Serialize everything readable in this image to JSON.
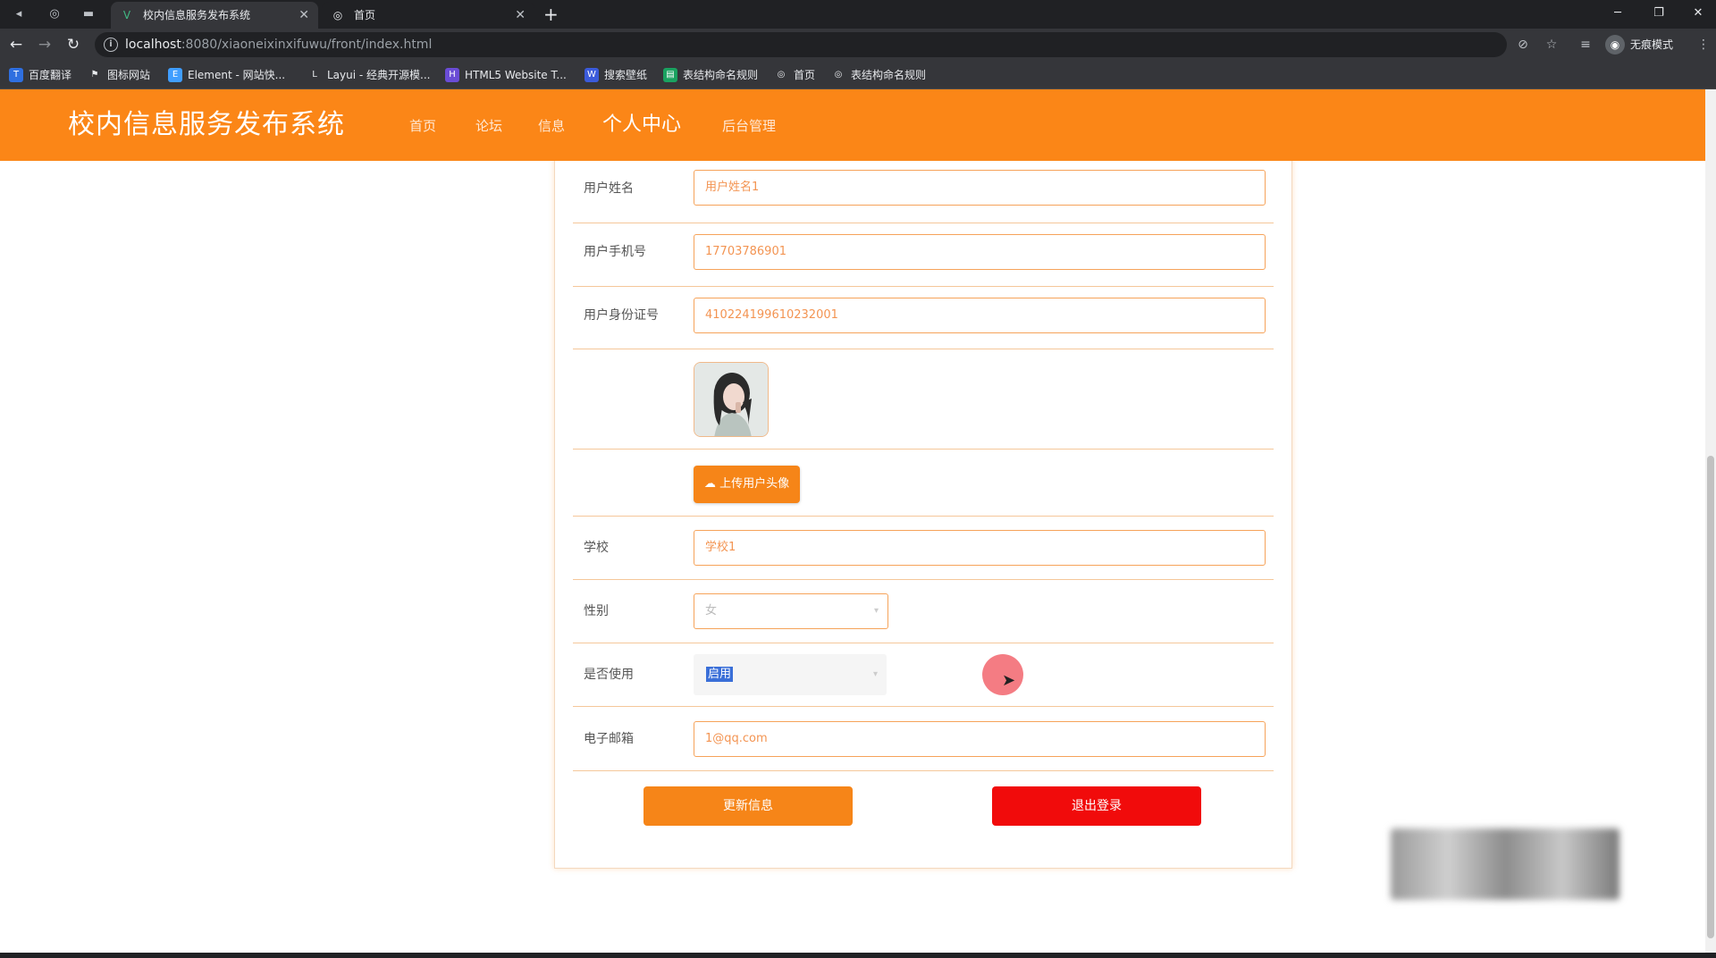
{
  "browser": {
    "tabs": [
      {
        "title": "校内信息服务发布系统",
        "icon": "vue-logo-icon"
      },
      {
        "title": "首页",
        "icon": "globe-icon"
      }
    ],
    "url": {
      "host": "localhost",
      "rest": ":8080/xiaoneixinxifuwu/front/index.html"
    },
    "profile_label": "无痕模式",
    "bookmarks": [
      "百度翻译",
      "图标网站",
      "Element - 网站快...",
      "Layui - 经典开源模...",
      "HTML5 Website T...",
      "搜索壁纸",
      "表结构命名规则",
      "首页",
      "表结构命名规则"
    ]
  },
  "site": {
    "title": "校内信息服务发布系统",
    "nav": [
      "首页",
      "论坛",
      "信息",
      "个人中心",
      "后台管理"
    ],
    "active_nav": "个人中心"
  },
  "form": {
    "name_label": "用户姓名",
    "name_value": "用户姓名1",
    "phone_label": "用户手机号",
    "phone_value": "17703786901",
    "idcard_label": "用户身份证号",
    "idcard_value": "410224199610232001",
    "upload_label": "上传用户头像",
    "school_label": "学校",
    "school_value": "学校1",
    "gender_label": "性别",
    "gender_value": "女",
    "status_label": "是否使用",
    "status_value": "启用",
    "email_label": "电子邮箱",
    "email_value": "1@qq.com"
  },
  "actions": {
    "update": "更新信息",
    "logout": "退出登录"
  },
  "colors": {
    "brand": "#fb8617",
    "logout": "#f10b0b"
  }
}
